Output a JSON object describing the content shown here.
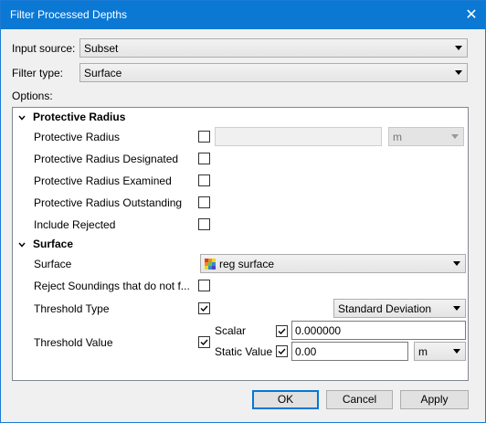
{
  "window": {
    "title": "Filter Processed Depths",
    "close_glyph": "✕"
  },
  "input_source": {
    "label": "Input source:",
    "value": "Subset"
  },
  "filter_type": {
    "label": "Filter type:",
    "value": "Surface"
  },
  "options_label": "Options:",
  "groups": {
    "protective_radius": {
      "title": "Protective Radius",
      "rows": [
        {
          "label": "Protective Radius",
          "checked": false,
          "value": "",
          "unit": "m"
        },
        {
          "label": "Protective Radius Designated",
          "checked": false
        },
        {
          "label": "Protective Radius Examined",
          "checked": false
        },
        {
          "label": "Protective Radius Outstanding",
          "checked": false
        },
        {
          "label": "Include Rejected",
          "checked": false
        }
      ]
    },
    "surface": {
      "title": "Surface",
      "surface_label": "Surface",
      "surface_value": "reg surface",
      "reject_label": "Reject Soundings that do not f...",
      "reject_checked": false,
      "threshold_type_label": "Threshold Type",
      "threshold_type_checked": true,
      "threshold_type_value": "Standard Deviation",
      "threshold_value_label": "Threshold Value",
      "threshold_value_checked": true,
      "scalar_label": "Scalar",
      "scalar_checked": true,
      "scalar_value": "0.000000",
      "static_label": "Static Value",
      "static_checked": true,
      "static_value": "0.00",
      "static_unit": "m"
    }
  },
  "buttons": {
    "ok": "OK",
    "cancel": "Cancel",
    "apply": "Apply"
  },
  "colors": {
    "titlebar": "#0b78d4",
    "accent": "#0078d7"
  }
}
